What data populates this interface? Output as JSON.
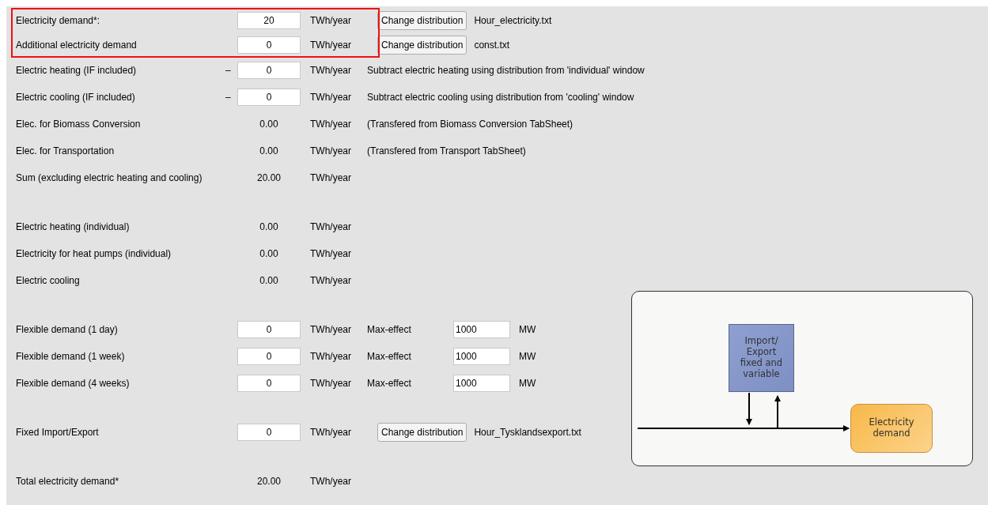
{
  "highlighted_rows": [
    {
      "kind": "input",
      "label": "Electricity demand*:",
      "value": "20",
      "unit": "TWh/year",
      "button": "Change distribution",
      "file": "Hour_electricity.txt"
    },
    {
      "kind": "input",
      "label": "Additional electricity demand",
      "value": "0",
      "unit": "TWh/year",
      "button": "Change distribution",
      "file": "const.txt"
    }
  ],
  "groups": [
    [
      {
        "kind": "input",
        "label": "Electric heating (IF included)",
        "sign": "–",
        "value": "0",
        "unit": "TWh/year",
        "note": "Subtract electric heating using distribution from 'individual' window"
      },
      {
        "kind": "input",
        "label": "Electric cooling (IF included)",
        "sign": "–",
        "value": "0",
        "unit": "TWh/year",
        "note": "Subtract electric cooling using distribution from 'cooling' window"
      },
      {
        "kind": "computed",
        "label": "Elec. for Biomass Conversion",
        "amount": "0.00",
        "unit": "TWh/year",
        "note": "(Transfered from Biomass Conversion TabSheet)"
      },
      {
        "kind": "computed",
        "label": "Elec. for Transportation",
        "amount": "0.00",
        "unit": "TWh/year",
        "note": "(Transfered from Transport TabSheet)"
      },
      {
        "kind": "computed",
        "label": "Sum (excluding electric heating and cooling)",
        "amount": "20.00",
        "unit": "TWh/year"
      }
    ],
    [
      {
        "kind": "computed",
        "label": "Electric heating (individual)",
        "amount": "0.00",
        "unit": "TWh/year"
      },
      {
        "kind": "computed",
        "label": "Electricity for heat pumps (individual)",
        "amount": "0.00",
        "unit": "TWh/year"
      },
      {
        "kind": "computed",
        "label": "Electric cooling",
        "amount": "0.00",
        "unit": "TWh/year"
      }
    ],
    [
      {
        "kind": "flex",
        "label": "Flexible demand (1 day)",
        "value": "0",
        "unit": "TWh/year",
        "max_label": "Max-effect",
        "max_value": "1000",
        "max_unit": "MW"
      },
      {
        "kind": "flex",
        "label": "Flexible demand (1 week)",
        "value": "0",
        "unit": "TWh/year",
        "max_label": "Max-effect",
        "max_value": "1000",
        "max_unit": "MW"
      },
      {
        "kind": "flex",
        "label": "Flexible demand (4 weeks)",
        "value": "0",
        "unit": "TWh/year",
        "max_label": "Max-effect",
        "max_value": "1000",
        "max_unit": "MW"
      }
    ],
    [
      {
        "kind": "input",
        "label": "Fixed Import/Export",
        "value": "0",
        "unit": "TWh/year",
        "button": "Change distribution",
        "file": "Hour_Tysklandsexport.txt"
      }
    ],
    [
      {
        "kind": "computed",
        "label": "Total electricity demand*",
        "amount": "20.00",
        "unit": "TWh/year"
      }
    ]
  ],
  "diagram": {
    "source_lines": [
      "Import/",
      "Export",
      "fixed and",
      "variable"
    ],
    "target_lines": [
      "Electricity",
      "demand"
    ]
  }
}
